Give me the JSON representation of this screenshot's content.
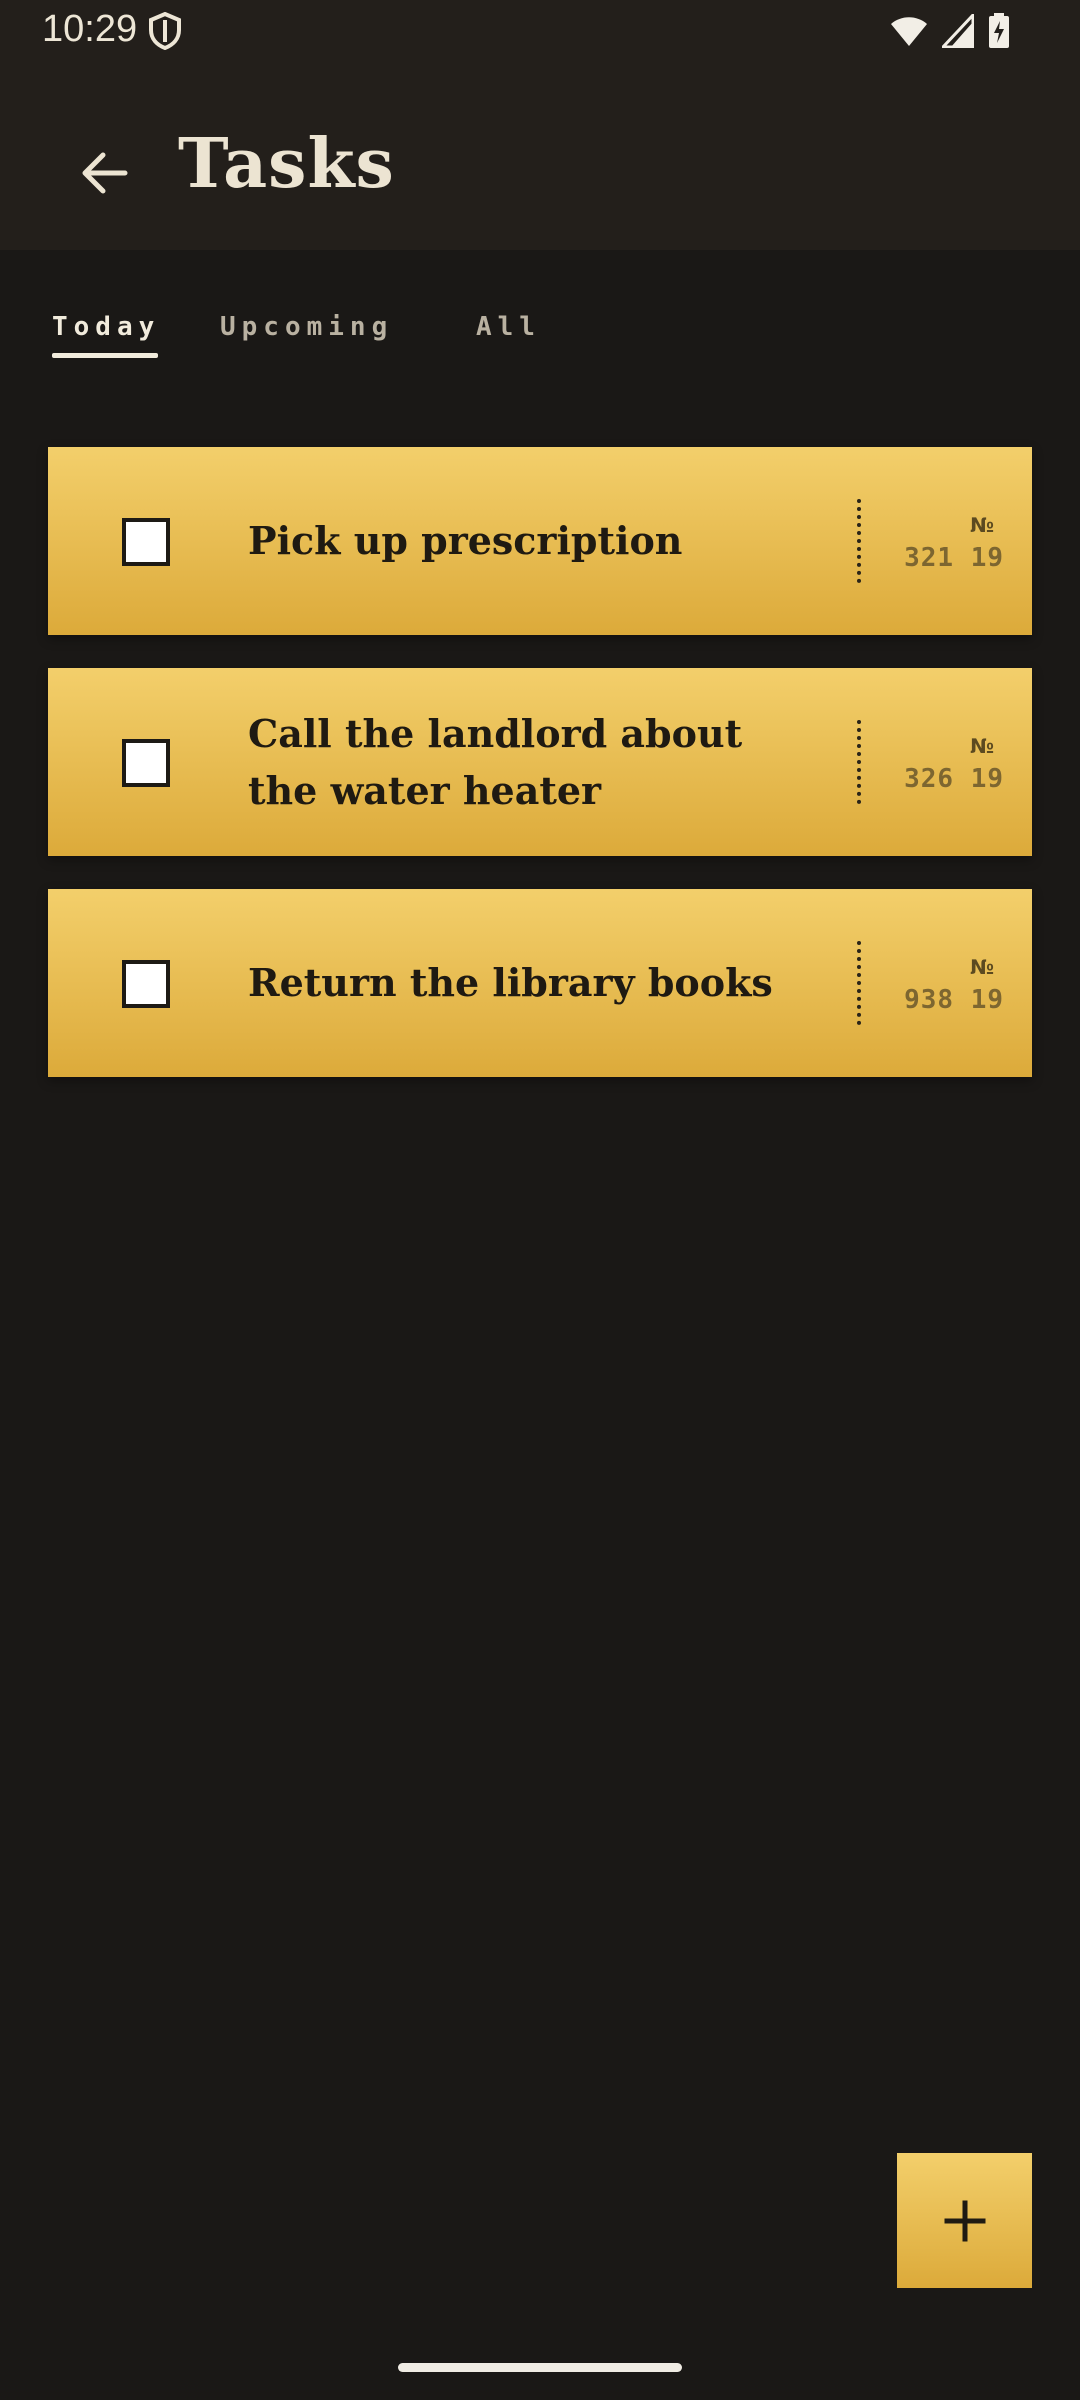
{
  "status_bar": {
    "time": "10:29",
    "icons": [
      "shield-icon",
      "wifi-icon",
      "cellular-icon",
      "battery-charging-icon"
    ]
  },
  "header": {
    "title": "Tasks",
    "back_icon": "arrow-back-icon"
  },
  "tabs": [
    {
      "label": "Today",
      "active": true
    },
    {
      "label": "Upcoming",
      "active": false
    },
    {
      "label": "All",
      "active": false
    }
  ],
  "tasks": [
    {
      "title": "Pick up prescription",
      "no_label": "№",
      "code": "321 19",
      "checked": false
    },
    {
      "title": "Call the landlord about the water heater",
      "no_label": "№",
      "code": "326 19",
      "checked": false
    },
    {
      "title": "Return the library books",
      "no_label": "№",
      "code": "938 19",
      "checked": false
    }
  ],
  "fab": {
    "icon": "plus-icon"
  },
  "colors": {
    "background": "#1a1816",
    "header": "#231f1b",
    "card_top": "#f3cf6b",
    "card_bottom": "#dcaa3a",
    "text_light": "#ece4d2"
  }
}
